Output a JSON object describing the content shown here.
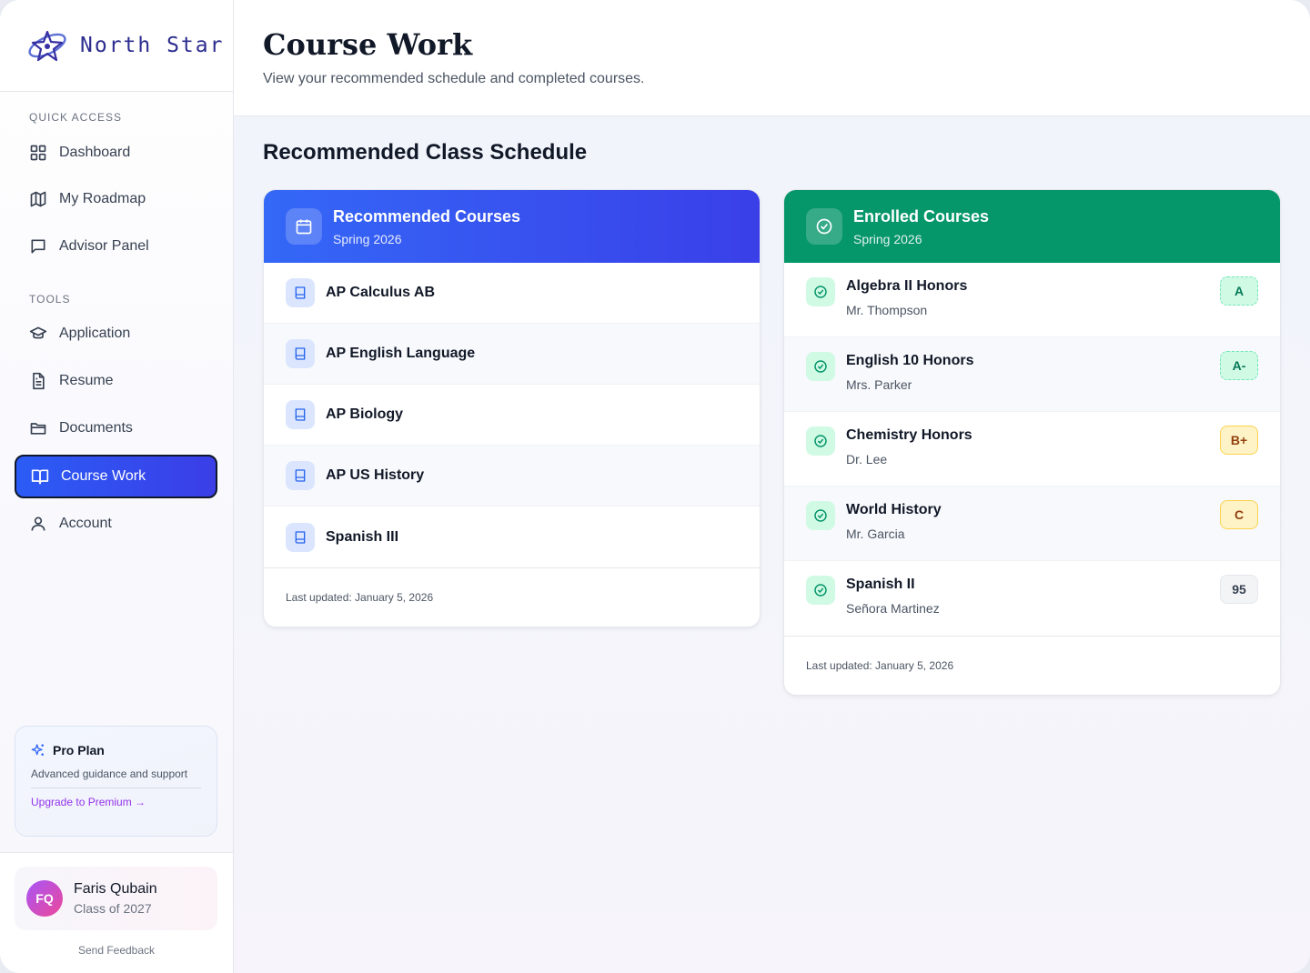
{
  "brand": {
    "name": "North Star"
  },
  "sidebar": {
    "quick_access_label": "QUICK ACCESS",
    "tools_label": "TOOLS",
    "quick_access": [
      {
        "label": "Dashboard",
        "icon": "grid-icon"
      },
      {
        "label": "My Roadmap",
        "icon": "map-icon"
      },
      {
        "label": "Advisor Panel",
        "icon": "message-icon"
      }
    ],
    "tools": [
      {
        "label": "Application",
        "icon": "graduation-cap-icon"
      },
      {
        "label": "Resume",
        "icon": "file-text-icon"
      },
      {
        "label": "Documents",
        "icon": "folder-icon"
      },
      {
        "label": "Course Work",
        "icon": "book-open-icon",
        "active": true
      },
      {
        "label": "Account",
        "icon": "user-icon"
      }
    ],
    "pro_plan": {
      "title": "Pro Plan",
      "description": "Advanced guidance and support",
      "link": "Upgrade to Premium →"
    },
    "user": {
      "initials": "FQ",
      "name": "Faris Qubain",
      "class": "Class of 2027"
    },
    "feedback": "Send Feedback"
  },
  "header": {
    "title": "Course Work",
    "subtitle": "View your recommended schedule and completed courses."
  },
  "main": {
    "section_title": "Recommended Class Schedule",
    "recommended": {
      "title": "Recommended Courses",
      "term": "Spring 2026",
      "courses": [
        "AP Calculus AB",
        "AP English Language",
        "AP Biology",
        "AP US History",
        "Spanish III"
      ],
      "footer": "Last updated: January 5, 2026"
    },
    "enrolled": {
      "title": "Enrolled Courses",
      "term": "Spring 2026",
      "courses": [
        {
          "name": "Algebra II Honors",
          "teacher": "Mr. Thompson",
          "grade": "A",
          "grade_style": "green"
        },
        {
          "name": "English 10 Honors",
          "teacher": "Mrs. Parker",
          "grade": "A-",
          "grade_style": "green"
        },
        {
          "name": "Chemistry Honors",
          "teacher": "Dr. Lee",
          "grade": "B+",
          "grade_style": "yellow"
        },
        {
          "name": "World History",
          "teacher": "Mr. Garcia",
          "grade": "C",
          "grade_style": "yellow"
        },
        {
          "name": "Spanish II",
          "teacher": "Señora Martinez",
          "grade": "95",
          "grade_style": "gray"
        }
      ],
      "footer": "Last updated: January 5, 2026"
    }
  },
  "colors": {
    "accent_blue": "#3468f7",
    "enrolled_green": "#059669",
    "brand_text": "#2c2d8f"
  }
}
